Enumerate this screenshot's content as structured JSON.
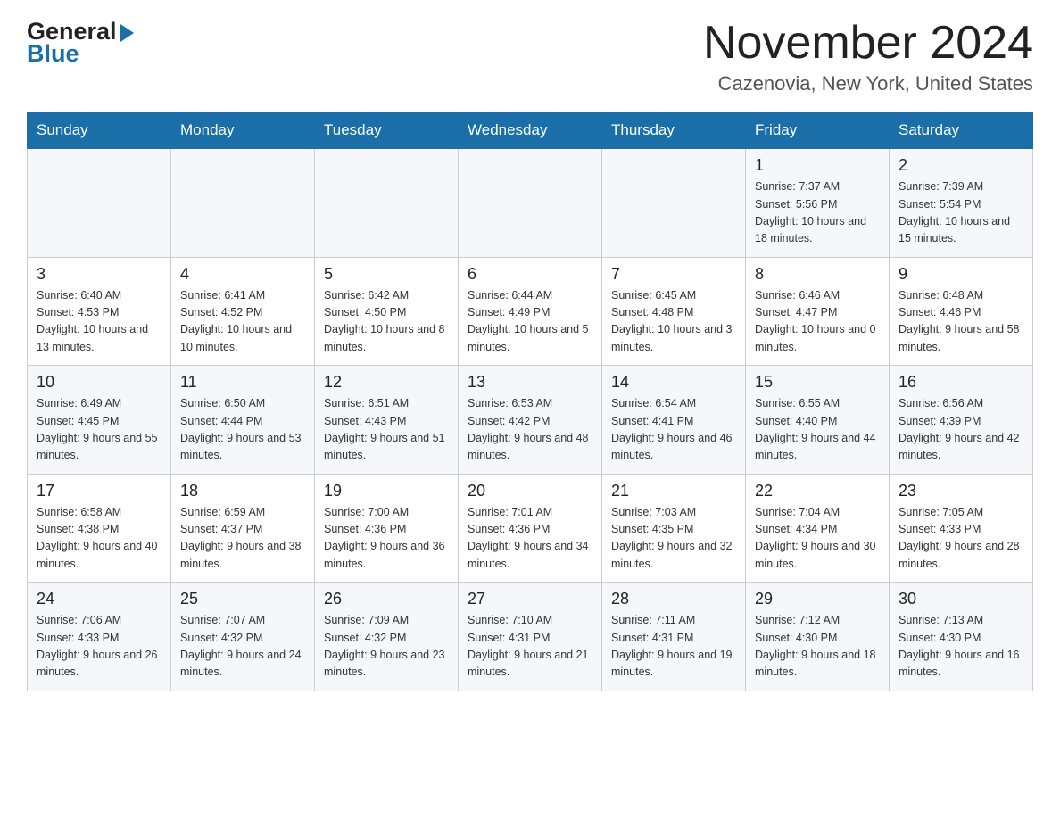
{
  "header": {
    "logo_general": "General",
    "logo_blue": "Blue",
    "title": "November 2024",
    "subtitle": "Cazenovia, New York, United States"
  },
  "days_of_week": [
    "Sunday",
    "Monday",
    "Tuesday",
    "Wednesday",
    "Thursday",
    "Friday",
    "Saturday"
  ],
  "weeks": [
    [
      {
        "day": "",
        "info": ""
      },
      {
        "day": "",
        "info": ""
      },
      {
        "day": "",
        "info": ""
      },
      {
        "day": "",
        "info": ""
      },
      {
        "day": "",
        "info": ""
      },
      {
        "day": "1",
        "info": "Sunrise: 7:37 AM\nSunset: 5:56 PM\nDaylight: 10 hours\nand 18 minutes."
      },
      {
        "day": "2",
        "info": "Sunrise: 7:39 AM\nSunset: 5:54 PM\nDaylight: 10 hours\nand 15 minutes."
      }
    ],
    [
      {
        "day": "3",
        "info": "Sunrise: 6:40 AM\nSunset: 4:53 PM\nDaylight: 10 hours\nand 13 minutes."
      },
      {
        "day": "4",
        "info": "Sunrise: 6:41 AM\nSunset: 4:52 PM\nDaylight: 10 hours\nand 10 minutes."
      },
      {
        "day": "5",
        "info": "Sunrise: 6:42 AM\nSunset: 4:50 PM\nDaylight: 10 hours\nand 8 minutes."
      },
      {
        "day": "6",
        "info": "Sunrise: 6:44 AM\nSunset: 4:49 PM\nDaylight: 10 hours\nand 5 minutes."
      },
      {
        "day": "7",
        "info": "Sunrise: 6:45 AM\nSunset: 4:48 PM\nDaylight: 10 hours\nand 3 minutes."
      },
      {
        "day": "8",
        "info": "Sunrise: 6:46 AM\nSunset: 4:47 PM\nDaylight: 10 hours\nand 0 minutes."
      },
      {
        "day": "9",
        "info": "Sunrise: 6:48 AM\nSunset: 4:46 PM\nDaylight: 9 hours\nand 58 minutes."
      }
    ],
    [
      {
        "day": "10",
        "info": "Sunrise: 6:49 AM\nSunset: 4:45 PM\nDaylight: 9 hours\nand 55 minutes."
      },
      {
        "day": "11",
        "info": "Sunrise: 6:50 AM\nSunset: 4:44 PM\nDaylight: 9 hours\nand 53 minutes."
      },
      {
        "day": "12",
        "info": "Sunrise: 6:51 AM\nSunset: 4:43 PM\nDaylight: 9 hours\nand 51 minutes."
      },
      {
        "day": "13",
        "info": "Sunrise: 6:53 AM\nSunset: 4:42 PM\nDaylight: 9 hours\nand 48 minutes."
      },
      {
        "day": "14",
        "info": "Sunrise: 6:54 AM\nSunset: 4:41 PM\nDaylight: 9 hours\nand 46 minutes."
      },
      {
        "day": "15",
        "info": "Sunrise: 6:55 AM\nSunset: 4:40 PM\nDaylight: 9 hours\nand 44 minutes."
      },
      {
        "day": "16",
        "info": "Sunrise: 6:56 AM\nSunset: 4:39 PM\nDaylight: 9 hours\nand 42 minutes."
      }
    ],
    [
      {
        "day": "17",
        "info": "Sunrise: 6:58 AM\nSunset: 4:38 PM\nDaylight: 9 hours\nand 40 minutes."
      },
      {
        "day": "18",
        "info": "Sunrise: 6:59 AM\nSunset: 4:37 PM\nDaylight: 9 hours\nand 38 minutes."
      },
      {
        "day": "19",
        "info": "Sunrise: 7:00 AM\nSunset: 4:36 PM\nDaylight: 9 hours\nand 36 minutes."
      },
      {
        "day": "20",
        "info": "Sunrise: 7:01 AM\nSunset: 4:36 PM\nDaylight: 9 hours\nand 34 minutes."
      },
      {
        "day": "21",
        "info": "Sunrise: 7:03 AM\nSunset: 4:35 PM\nDaylight: 9 hours\nand 32 minutes."
      },
      {
        "day": "22",
        "info": "Sunrise: 7:04 AM\nSunset: 4:34 PM\nDaylight: 9 hours\nand 30 minutes."
      },
      {
        "day": "23",
        "info": "Sunrise: 7:05 AM\nSunset: 4:33 PM\nDaylight: 9 hours\nand 28 minutes."
      }
    ],
    [
      {
        "day": "24",
        "info": "Sunrise: 7:06 AM\nSunset: 4:33 PM\nDaylight: 9 hours\nand 26 minutes."
      },
      {
        "day": "25",
        "info": "Sunrise: 7:07 AM\nSunset: 4:32 PM\nDaylight: 9 hours\nand 24 minutes."
      },
      {
        "day": "26",
        "info": "Sunrise: 7:09 AM\nSunset: 4:32 PM\nDaylight: 9 hours\nand 23 minutes."
      },
      {
        "day": "27",
        "info": "Sunrise: 7:10 AM\nSunset: 4:31 PM\nDaylight: 9 hours\nand 21 minutes."
      },
      {
        "day": "28",
        "info": "Sunrise: 7:11 AM\nSunset: 4:31 PM\nDaylight: 9 hours\nand 19 minutes."
      },
      {
        "day": "29",
        "info": "Sunrise: 7:12 AM\nSunset: 4:30 PM\nDaylight: 9 hours\nand 18 minutes."
      },
      {
        "day": "30",
        "info": "Sunrise: 7:13 AM\nSunset: 4:30 PM\nDaylight: 9 hours\nand 16 minutes."
      }
    ]
  ]
}
